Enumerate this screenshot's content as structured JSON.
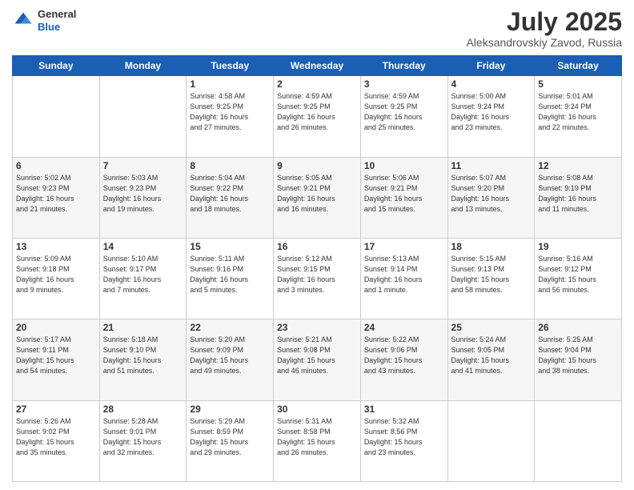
{
  "header": {
    "logo_general": "General",
    "logo_blue": "Blue",
    "title": "July 2025",
    "location": "Aleksandrovskiy Zavod, Russia"
  },
  "weekdays": [
    "Sunday",
    "Monday",
    "Tuesday",
    "Wednesday",
    "Thursday",
    "Friday",
    "Saturday"
  ],
  "weeks": [
    [
      {
        "day": "",
        "info": ""
      },
      {
        "day": "",
        "info": ""
      },
      {
        "day": "1",
        "info": "Sunrise: 4:58 AM\nSunset: 9:25 PM\nDaylight: 16 hours\nand 27 minutes."
      },
      {
        "day": "2",
        "info": "Sunrise: 4:59 AM\nSunset: 9:25 PM\nDaylight: 16 hours\nand 26 minutes."
      },
      {
        "day": "3",
        "info": "Sunrise: 4:59 AM\nSunset: 9:25 PM\nDaylight: 16 hours\nand 25 minutes."
      },
      {
        "day": "4",
        "info": "Sunrise: 5:00 AM\nSunset: 9:24 PM\nDaylight: 16 hours\nand 23 minutes."
      },
      {
        "day": "5",
        "info": "Sunrise: 5:01 AM\nSunset: 9:24 PM\nDaylight: 16 hours\nand 22 minutes."
      }
    ],
    [
      {
        "day": "6",
        "info": "Sunrise: 5:02 AM\nSunset: 9:23 PM\nDaylight: 16 hours\nand 21 minutes."
      },
      {
        "day": "7",
        "info": "Sunrise: 5:03 AM\nSunset: 9:23 PM\nDaylight: 16 hours\nand 19 minutes."
      },
      {
        "day": "8",
        "info": "Sunrise: 5:04 AM\nSunset: 9:22 PM\nDaylight: 16 hours\nand 18 minutes."
      },
      {
        "day": "9",
        "info": "Sunrise: 5:05 AM\nSunset: 9:21 PM\nDaylight: 16 hours\nand 16 minutes."
      },
      {
        "day": "10",
        "info": "Sunrise: 5:06 AM\nSunset: 9:21 PM\nDaylight: 16 hours\nand 15 minutes."
      },
      {
        "day": "11",
        "info": "Sunrise: 5:07 AM\nSunset: 9:20 PM\nDaylight: 16 hours\nand 13 minutes."
      },
      {
        "day": "12",
        "info": "Sunrise: 5:08 AM\nSunset: 9:19 PM\nDaylight: 16 hours\nand 11 minutes."
      }
    ],
    [
      {
        "day": "13",
        "info": "Sunrise: 5:09 AM\nSunset: 9:18 PM\nDaylight: 16 hours\nand 9 minutes."
      },
      {
        "day": "14",
        "info": "Sunrise: 5:10 AM\nSunset: 9:17 PM\nDaylight: 16 hours\nand 7 minutes."
      },
      {
        "day": "15",
        "info": "Sunrise: 5:11 AM\nSunset: 9:16 PM\nDaylight: 16 hours\nand 5 minutes."
      },
      {
        "day": "16",
        "info": "Sunrise: 5:12 AM\nSunset: 9:15 PM\nDaylight: 16 hours\nand 3 minutes."
      },
      {
        "day": "17",
        "info": "Sunrise: 5:13 AM\nSunset: 9:14 PM\nDaylight: 16 hours\nand 1 minute."
      },
      {
        "day": "18",
        "info": "Sunrise: 5:15 AM\nSunset: 9:13 PM\nDaylight: 15 hours\nand 58 minutes."
      },
      {
        "day": "19",
        "info": "Sunrise: 5:16 AM\nSunset: 9:12 PM\nDaylight: 15 hours\nand 56 minutes."
      }
    ],
    [
      {
        "day": "20",
        "info": "Sunrise: 5:17 AM\nSunset: 9:11 PM\nDaylight: 15 hours\nand 54 minutes."
      },
      {
        "day": "21",
        "info": "Sunrise: 5:18 AM\nSunset: 9:10 PM\nDaylight: 15 hours\nand 51 minutes."
      },
      {
        "day": "22",
        "info": "Sunrise: 5:20 AM\nSunset: 9:09 PM\nDaylight: 15 hours\nand 49 minutes."
      },
      {
        "day": "23",
        "info": "Sunrise: 5:21 AM\nSunset: 9:08 PM\nDaylight: 15 hours\nand 46 minutes."
      },
      {
        "day": "24",
        "info": "Sunrise: 5:22 AM\nSunset: 9:06 PM\nDaylight: 15 hours\nand 43 minutes."
      },
      {
        "day": "25",
        "info": "Sunrise: 5:24 AM\nSunset: 9:05 PM\nDaylight: 15 hours\nand 41 minutes."
      },
      {
        "day": "26",
        "info": "Sunrise: 5:25 AM\nSunset: 9:04 PM\nDaylight: 15 hours\nand 38 minutes."
      }
    ],
    [
      {
        "day": "27",
        "info": "Sunrise: 5:26 AM\nSunset: 9:02 PM\nDaylight: 15 hours\nand 35 minutes."
      },
      {
        "day": "28",
        "info": "Sunrise: 5:28 AM\nSunset: 9:01 PM\nDaylight: 15 hours\nand 32 minutes."
      },
      {
        "day": "29",
        "info": "Sunrise: 5:29 AM\nSunset: 8:59 PM\nDaylight: 15 hours\nand 29 minutes."
      },
      {
        "day": "30",
        "info": "Sunrise: 5:31 AM\nSunset: 8:58 PM\nDaylight: 15 hours\nand 26 minutes."
      },
      {
        "day": "31",
        "info": "Sunrise: 5:32 AM\nSunset: 8:56 PM\nDaylight: 15 hours\nand 23 minutes."
      },
      {
        "day": "",
        "info": ""
      },
      {
        "day": "",
        "info": ""
      }
    ]
  ]
}
